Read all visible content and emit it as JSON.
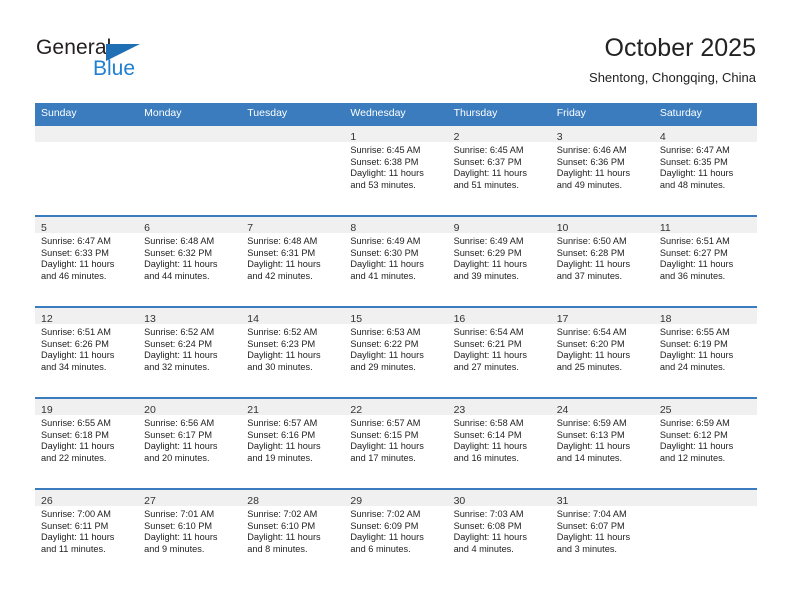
{
  "brand": {
    "name_part1": "General",
    "name_part2": "Blue"
  },
  "header": {
    "title": "October 2025",
    "subtitle": "Shentong, Chongqing, China"
  },
  "colors": {
    "header_blue": "#3a7cbe",
    "logo_blue": "#1f7fd0",
    "daynum_band": "#f0f0f0",
    "text": "#222222"
  },
  "calendar": {
    "weekday_headers": [
      "Sunday",
      "Monday",
      "Tuesday",
      "Wednesday",
      "Thursday",
      "Friday",
      "Saturday"
    ],
    "labels": {
      "sunrise": "Sunrise:",
      "sunset": "Sunset:",
      "daylight": "Daylight:"
    },
    "weeks": [
      [
        {
          "day": "",
          "sunrise": "",
          "sunset": "",
          "daylight_1": "",
          "daylight_2": ""
        },
        {
          "day": "",
          "sunrise": "",
          "sunset": "",
          "daylight_1": "",
          "daylight_2": ""
        },
        {
          "day": "",
          "sunrise": "",
          "sunset": "",
          "daylight_1": "",
          "daylight_2": ""
        },
        {
          "day": "1",
          "sunrise": "Sunrise: 6:45 AM",
          "sunset": "Sunset: 6:38 PM",
          "daylight_1": "Daylight: 11 hours",
          "daylight_2": "and 53 minutes."
        },
        {
          "day": "2",
          "sunrise": "Sunrise: 6:45 AM",
          "sunset": "Sunset: 6:37 PM",
          "daylight_1": "Daylight: 11 hours",
          "daylight_2": "and 51 minutes."
        },
        {
          "day": "3",
          "sunrise": "Sunrise: 6:46 AM",
          "sunset": "Sunset: 6:36 PM",
          "daylight_1": "Daylight: 11 hours",
          "daylight_2": "and 49 minutes."
        },
        {
          "day": "4",
          "sunrise": "Sunrise: 6:47 AM",
          "sunset": "Sunset: 6:35 PM",
          "daylight_1": "Daylight: 11 hours",
          "daylight_2": "and 48 minutes."
        }
      ],
      [
        {
          "day": "5",
          "sunrise": "Sunrise: 6:47 AM",
          "sunset": "Sunset: 6:33 PM",
          "daylight_1": "Daylight: 11 hours",
          "daylight_2": "and 46 minutes."
        },
        {
          "day": "6",
          "sunrise": "Sunrise: 6:48 AM",
          "sunset": "Sunset: 6:32 PM",
          "daylight_1": "Daylight: 11 hours",
          "daylight_2": "and 44 minutes."
        },
        {
          "day": "7",
          "sunrise": "Sunrise: 6:48 AM",
          "sunset": "Sunset: 6:31 PM",
          "daylight_1": "Daylight: 11 hours",
          "daylight_2": "and 42 minutes."
        },
        {
          "day": "8",
          "sunrise": "Sunrise: 6:49 AM",
          "sunset": "Sunset: 6:30 PM",
          "daylight_1": "Daylight: 11 hours",
          "daylight_2": "and 41 minutes."
        },
        {
          "day": "9",
          "sunrise": "Sunrise: 6:49 AM",
          "sunset": "Sunset: 6:29 PM",
          "daylight_1": "Daylight: 11 hours",
          "daylight_2": "and 39 minutes."
        },
        {
          "day": "10",
          "sunrise": "Sunrise: 6:50 AM",
          "sunset": "Sunset: 6:28 PM",
          "daylight_1": "Daylight: 11 hours",
          "daylight_2": "and 37 minutes."
        },
        {
          "day": "11",
          "sunrise": "Sunrise: 6:51 AM",
          "sunset": "Sunset: 6:27 PM",
          "daylight_1": "Daylight: 11 hours",
          "daylight_2": "and 36 minutes."
        }
      ],
      [
        {
          "day": "12",
          "sunrise": "Sunrise: 6:51 AM",
          "sunset": "Sunset: 6:26 PM",
          "daylight_1": "Daylight: 11 hours",
          "daylight_2": "and 34 minutes."
        },
        {
          "day": "13",
          "sunrise": "Sunrise: 6:52 AM",
          "sunset": "Sunset: 6:24 PM",
          "daylight_1": "Daylight: 11 hours",
          "daylight_2": "and 32 minutes."
        },
        {
          "day": "14",
          "sunrise": "Sunrise: 6:52 AM",
          "sunset": "Sunset: 6:23 PM",
          "daylight_1": "Daylight: 11 hours",
          "daylight_2": "and 30 minutes."
        },
        {
          "day": "15",
          "sunrise": "Sunrise: 6:53 AM",
          "sunset": "Sunset: 6:22 PM",
          "daylight_1": "Daylight: 11 hours",
          "daylight_2": "and 29 minutes."
        },
        {
          "day": "16",
          "sunrise": "Sunrise: 6:54 AM",
          "sunset": "Sunset: 6:21 PM",
          "daylight_1": "Daylight: 11 hours",
          "daylight_2": "and 27 minutes."
        },
        {
          "day": "17",
          "sunrise": "Sunrise: 6:54 AM",
          "sunset": "Sunset: 6:20 PM",
          "daylight_1": "Daylight: 11 hours",
          "daylight_2": "and 25 minutes."
        },
        {
          "day": "18",
          "sunrise": "Sunrise: 6:55 AM",
          "sunset": "Sunset: 6:19 PM",
          "daylight_1": "Daylight: 11 hours",
          "daylight_2": "and 24 minutes."
        }
      ],
      [
        {
          "day": "19",
          "sunrise": "Sunrise: 6:55 AM",
          "sunset": "Sunset: 6:18 PM",
          "daylight_1": "Daylight: 11 hours",
          "daylight_2": "and 22 minutes."
        },
        {
          "day": "20",
          "sunrise": "Sunrise: 6:56 AM",
          "sunset": "Sunset: 6:17 PM",
          "daylight_1": "Daylight: 11 hours",
          "daylight_2": "and 20 minutes."
        },
        {
          "day": "21",
          "sunrise": "Sunrise: 6:57 AM",
          "sunset": "Sunset: 6:16 PM",
          "daylight_1": "Daylight: 11 hours",
          "daylight_2": "and 19 minutes."
        },
        {
          "day": "22",
          "sunrise": "Sunrise: 6:57 AM",
          "sunset": "Sunset: 6:15 PM",
          "daylight_1": "Daylight: 11 hours",
          "daylight_2": "and 17 minutes."
        },
        {
          "day": "23",
          "sunrise": "Sunrise: 6:58 AM",
          "sunset": "Sunset: 6:14 PM",
          "daylight_1": "Daylight: 11 hours",
          "daylight_2": "and 16 minutes."
        },
        {
          "day": "24",
          "sunrise": "Sunrise: 6:59 AM",
          "sunset": "Sunset: 6:13 PM",
          "daylight_1": "Daylight: 11 hours",
          "daylight_2": "and 14 minutes."
        },
        {
          "day": "25",
          "sunrise": "Sunrise: 6:59 AM",
          "sunset": "Sunset: 6:12 PM",
          "daylight_1": "Daylight: 11 hours",
          "daylight_2": "and 12 minutes."
        }
      ],
      [
        {
          "day": "26",
          "sunrise": "Sunrise: 7:00 AM",
          "sunset": "Sunset: 6:11 PM",
          "daylight_1": "Daylight: 11 hours",
          "daylight_2": "and 11 minutes."
        },
        {
          "day": "27",
          "sunrise": "Sunrise: 7:01 AM",
          "sunset": "Sunset: 6:10 PM",
          "daylight_1": "Daylight: 11 hours",
          "daylight_2": "and 9 minutes."
        },
        {
          "day": "28",
          "sunrise": "Sunrise: 7:02 AM",
          "sunset": "Sunset: 6:10 PM",
          "daylight_1": "Daylight: 11 hours",
          "daylight_2": "and 8 minutes."
        },
        {
          "day": "29",
          "sunrise": "Sunrise: 7:02 AM",
          "sunset": "Sunset: 6:09 PM",
          "daylight_1": "Daylight: 11 hours",
          "daylight_2": "and 6 minutes."
        },
        {
          "day": "30",
          "sunrise": "Sunrise: 7:03 AM",
          "sunset": "Sunset: 6:08 PM",
          "daylight_1": "Daylight: 11 hours",
          "daylight_2": "and 4 minutes."
        },
        {
          "day": "31",
          "sunrise": "Sunrise: 7:04 AM",
          "sunset": "Sunset: 6:07 PM",
          "daylight_1": "Daylight: 11 hours",
          "daylight_2": "and 3 minutes."
        },
        {
          "day": "",
          "sunrise": "",
          "sunset": "",
          "daylight_1": "",
          "daylight_2": ""
        }
      ]
    ]
  }
}
